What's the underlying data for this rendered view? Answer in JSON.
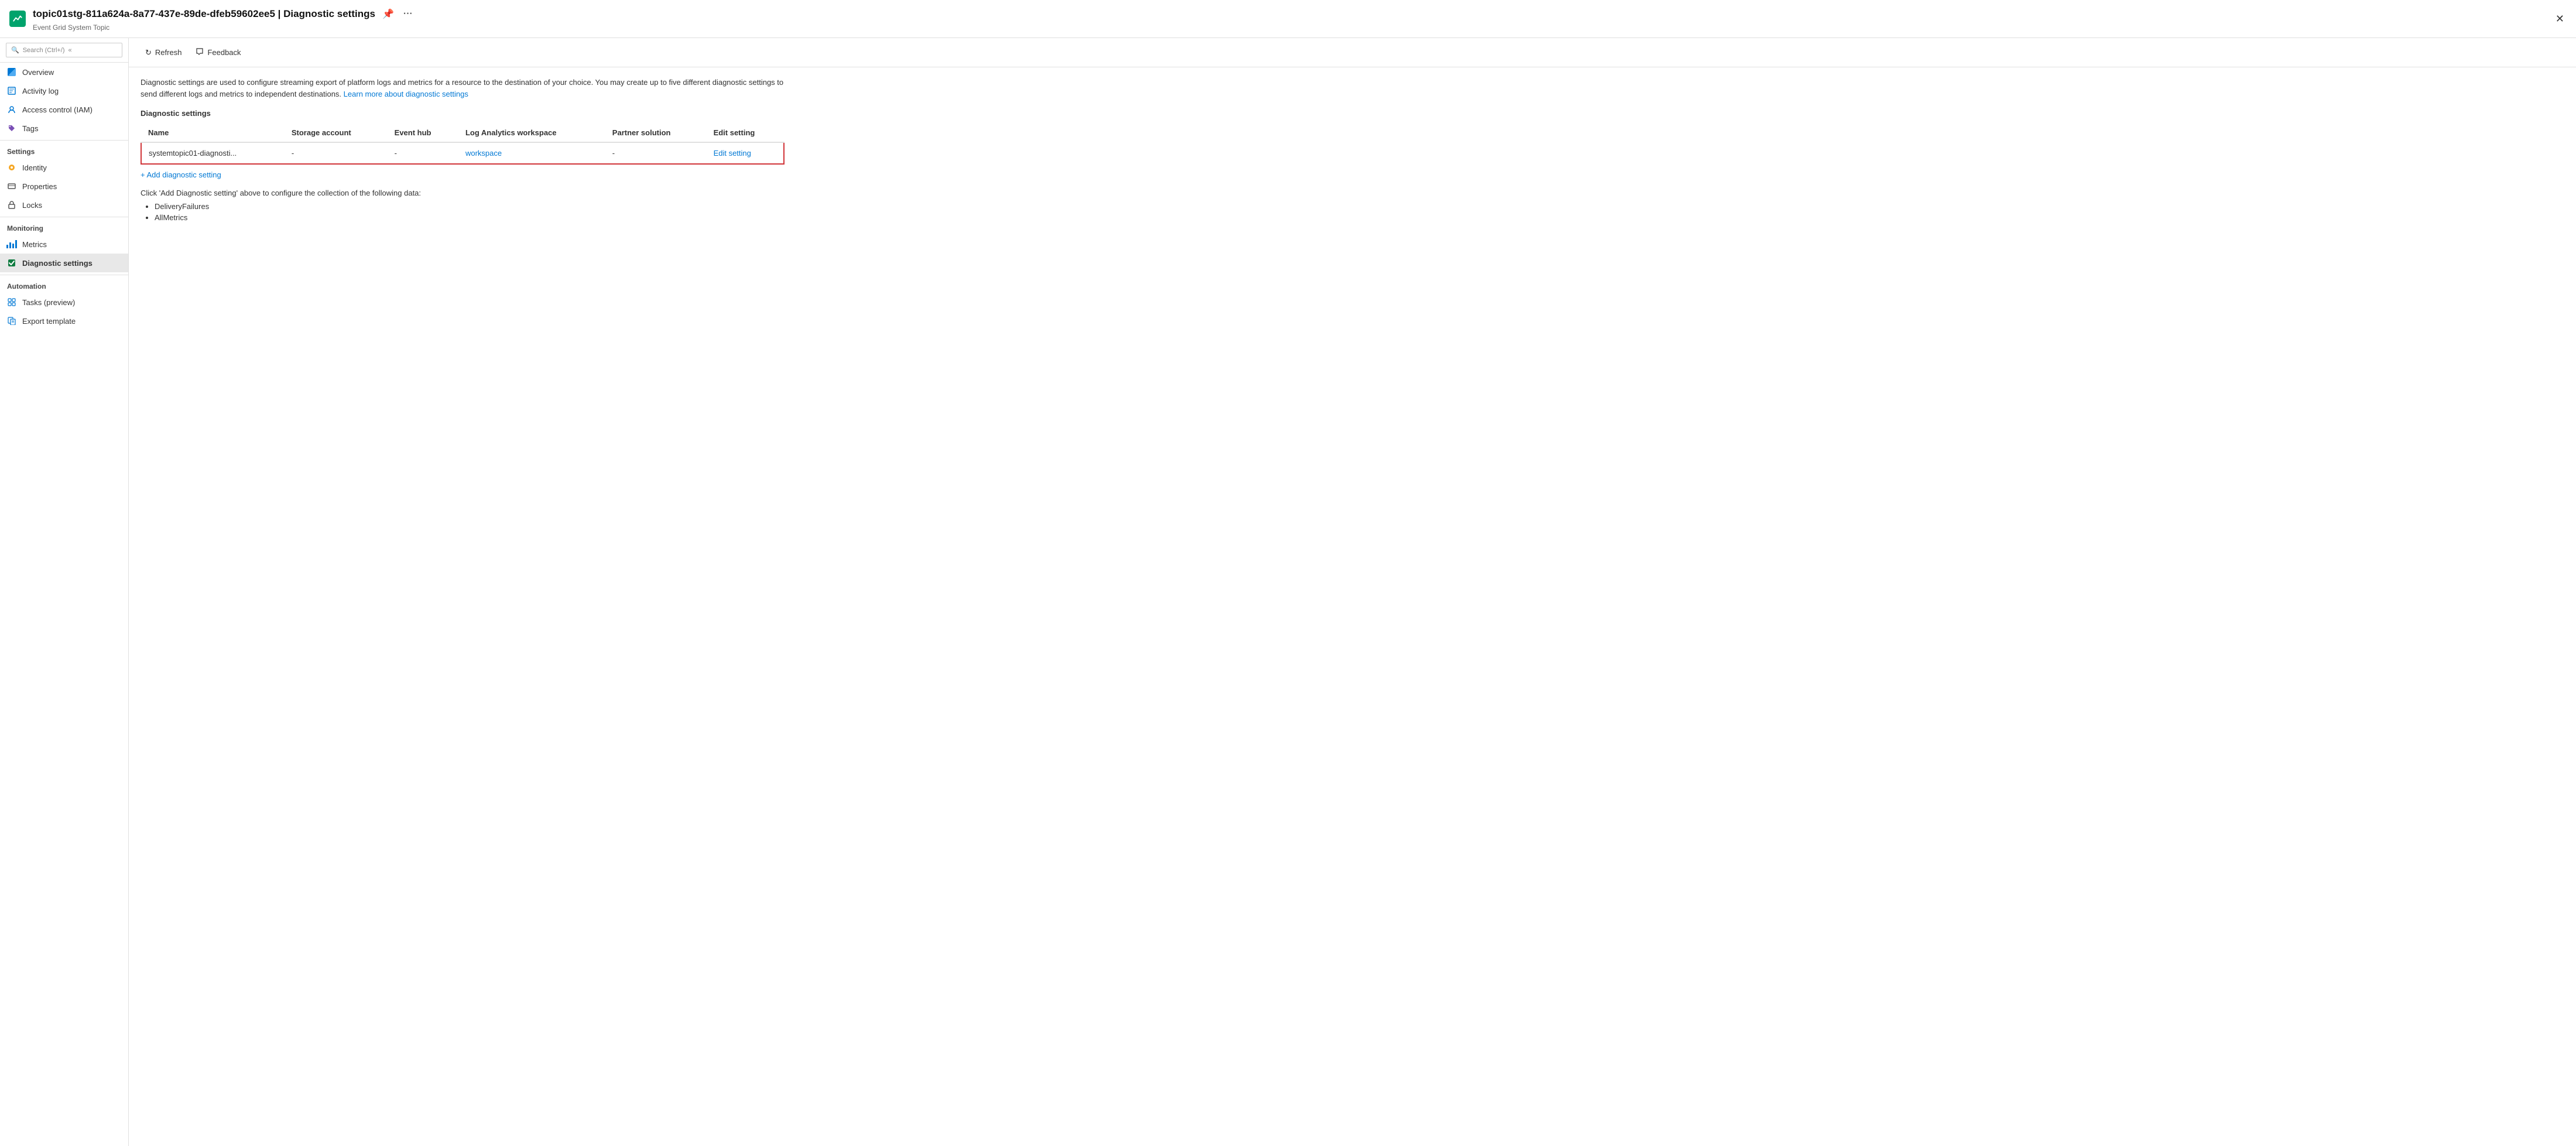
{
  "header": {
    "icon_alt": "event-grid-icon",
    "title": "topic01stg-811a624a-8a77-437e-89de-dfeb59602ee5 | Diagnostic settings",
    "subtitle": "Event Grid System Topic",
    "pin_label": "📌",
    "more_label": "···",
    "close_label": "✕"
  },
  "sidebar": {
    "search_placeholder": "Search (Ctrl+/)",
    "collapse_label": "«",
    "items": [
      {
        "id": "overview",
        "label": "Overview",
        "icon": "overview-icon",
        "active": false
      },
      {
        "id": "activity-log",
        "label": "Activity log",
        "icon": "activity-log-icon",
        "active": false
      },
      {
        "id": "access-control",
        "label": "Access control (IAM)",
        "icon": "iam-icon",
        "active": false
      },
      {
        "id": "tags",
        "label": "Tags",
        "icon": "tags-icon",
        "active": false
      }
    ],
    "sections": [
      {
        "label": "Settings",
        "items": [
          {
            "id": "identity",
            "label": "Identity",
            "icon": "identity-icon",
            "active": false
          },
          {
            "id": "properties",
            "label": "Properties",
            "icon": "properties-icon",
            "active": false
          },
          {
            "id": "locks",
            "label": "Locks",
            "icon": "locks-icon",
            "active": false
          }
        ]
      },
      {
        "label": "Monitoring",
        "items": [
          {
            "id": "metrics",
            "label": "Metrics",
            "icon": "metrics-icon",
            "active": false
          },
          {
            "id": "diagnostic-settings",
            "label": "Diagnostic settings",
            "icon": "diagnostic-settings-icon",
            "active": true
          }
        ]
      },
      {
        "label": "Automation",
        "items": [
          {
            "id": "tasks-preview",
            "label": "Tasks (preview)",
            "icon": "tasks-icon",
            "active": false
          },
          {
            "id": "export-template",
            "label": "Export template",
            "icon": "export-icon",
            "active": false
          }
        ]
      }
    ]
  },
  "toolbar": {
    "refresh_label": "Refresh",
    "feedback_label": "Feedback"
  },
  "content": {
    "description": "Diagnostic settings are used to configure streaming export of platform logs and metrics for a resource to the destination of your choice. You may create up to five different diagnostic settings to send different logs and metrics to independent destinations.",
    "learn_more_text": "Learn more about diagnostic settings",
    "section_title": "Diagnostic settings",
    "table": {
      "columns": [
        "Name",
        "Storage account",
        "Event hub",
        "Log Analytics workspace",
        "Partner solution",
        "Edit setting"
      ],
      "rows": [
        {
          "name": "systemtopic01-diagnosti...",
          "storage_account": "-",
          "event_hub": "-",
          "log_analytics_workspace": "workspace",
          "partner_solution": "-",
          "edit_setting": "Edit setting",
          "highlighted": true
        }
      ]
    },
    "add_link": "+ Add diagnostic setting",
    "configure_text": "Click 'Add Diagnostic setting' above to configure the collection of the following data:",
    "bullet_items": [
      "DeliveryFailures",
      "AllMetrics"
    ]
  }
}
